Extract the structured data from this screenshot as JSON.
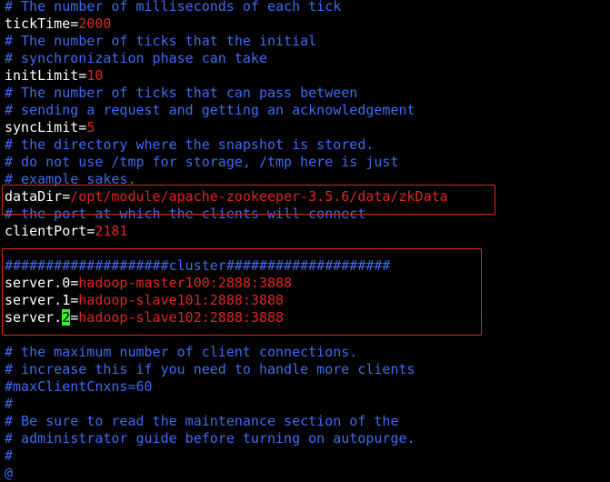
{
  "colors": {
    "background": "#000000",
    "comment": "#3b6cf2",
    "key": "#ffffff",
    "value": "#e0261f",
    "cursor": "#36f51f",
    "highlight_box": "#e0261f"
  },
  "lines": {
    "l1": {
      "comment": "# The number of milliseconds of each tick"
    },
    "l2": {
      "key": "tickTime",
      "op": "=",
      "value": "2000"
    },
    "l3": {
      "comment": "# The number of ticks that the initial"
    },
    "l4": {
      "comment": "# synchronization phase can take"
    },
    "l5": {
      "key": "initLimit",
      "op": "=",
      "value": "10"
    },
    "l6": {
      "comment": "# The number of ticks that can pass between"
    },
    "l7": {
      "comment": "# sending a request and getting an acknowledgement"
    },
    "l8": {
      "key": "syncLimit",
      "op": "=",
      "value": "5"
    },
    "l9": {
      "comment": "# the directory where the snapshot is stored."
    },
    "l10": {
      "comment": "# do not use /tmp for storage, /tmp here is just"
    },
    "l11": {
      "comment": "# example sakes."
    },
    "l12": {
      "key": "dataDir",
      "op": "=",
      "value": "/opt/module/apache-zookeeper-3.5.6/data/zkData"
    },
    "l13": {
      "comment": "# the port at which the clients will connect"
    },
    "l14": {
      "key": "clientPort",
      "op": "=",
      "value": "2181"
    },
    "l15": {
      "comment": ""
    },
    "l16": {
      "comment": "####################cluster####################"
    },
    "l17": {
      "key": "server.0",
      "op": "=",
      "value": "hadoop-master100:2888:3888"
    },
    "l18": {
      "key": "server.1",
      "op": "=",
      "value": "hadoop-slave101:2888:3888"
    },
    "l19": {
      "key_prefix": "server.",
      "cursor_char": "2",
      "op": "=",
      "value": "hadoop-slave102:2888:3888"
    },
    "l20": {
      "comment": ""
    },
    "l21": {
      "comment": "# the maximum number of client connections."
    },
    "l22": {
      "comment": "# increase this if you need to handle more clients"
    },
    "l23": {
      "comment": "#maxClientCnxns=60"
    },
    "l24": {
      "comment": "#"
    },
    "l25": {
      "comment": "# Be sure to read the maintenance section of the"
    },
    "l26": {
      "comment": "# administrator guide before turning on autopurge."
    },
    "l27": {
      "comment": "#"
    },
    "l28": {
      "comment": "@"
    }
  }
}
